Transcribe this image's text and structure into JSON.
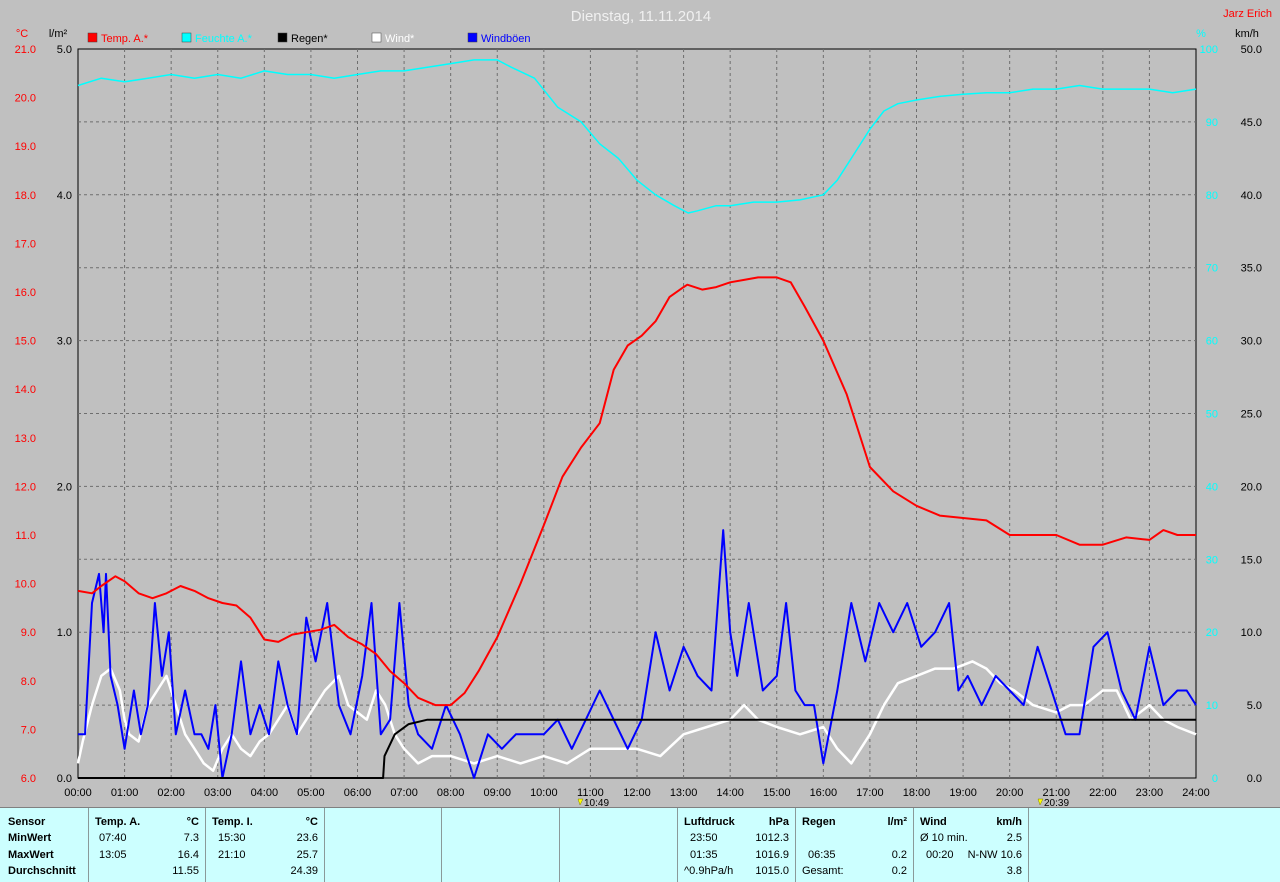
{
  "header": {
    "title": "Dienstag, 11.11.2014",
    "author": "Jarz Erich"
  },
  "axes": {
    "left_temp_unit": "°C",
    "left_rain_unit": "l/m²",
    "right_hum_unit": "%",
    "right_wind_unit": "km/h",
    "temp_ticks": [
      "21.0",
      "20.0",
      "19.0",
      "18.0",
      "17.0",
      "16.0",
      "15.0",
      "14.0",
      "13.0",
      "12.0",
      "11.0",
      "10.0",
      "9.0",
      "8.0",
      "7.0",
      "6.0"
    ],
    "rain_ticks": [
      "5.0",
      "4.0",
      "3.0",
      "2.0",
      "1.0",
      "0.0"
    ],
    "hum_ticks": [
      "100",
      "90",
      "80",
      "70",
      "60",
      "50",
      "40",
      "30",
      "20",
      "10",
      "0"
    ],
    "wind_ticks": [
      "50.0",
      "45.0",
      "40.0",
      "35.0",
      "30.0",
      "25.0",
      "20.0",
      "15.0",
      "10.0",
      "5.0",
      "0.0"
    ],
    "time_ticks": [
      "00:00",
      "01:00",
      "02:00",
      "03:00",
      "04:00",
      "05:00",
      "06:00",
      "07:00",
      "08:00",
      "09:00",
      "10:00",
      "11:00",
      "12:00",
      "13:00",
      "14:00",
      "15:00",
      "16:00",
      "17:00",
      "18:00",
      "19:00",
      "20:00",
      "21:00",
      "22:00",
      "23:00",
      "24:00"
    ],
    "sunrise": "10:49",
    "sunset": "20:39"
  },
  "legend": [
    {
      "label": "Temp. A.*",
      "color": "#ff0000"
    },
    {
      "label": "Feuchte A.*",
      "color": "#00ffff"
    },
    {
      "label": "Regen*",
      "color": "#000000"
    },
    {
      "label": "Wind*",
      "color": "#ffffff"
    },
    {
      "label": "Windböen",
      "color": "#0000ff"
    }
  ],
  "chart_data": {
    "type": "line",
    "title": "Dienstag, 11.11.2014",
    "x_unit": "hours",
    "xlim": [
      0,
      24
    ],
    "grid": true,
    "series": [
      {
        "name": "Temp. A.*",
        "color": "#ff0000",
        "axis": "temp",
        "ylim": [
          6,
          21
        ],
        "x": [
          0,
          0.3,
          0.5,
          0.8,
          1.0,
          1.3,
          1.6,
          1.9,
          2.2,
          2.5,
          2.8,
          3.1,
          3.4,
          3.7,
          4.0,
          4.3,
          4.6,
          4.9,
          5.2,
          5.5,
          5.8,
          6.1,
          6.4,
          6.7,
          7.0,
          7.3,
          7.67,
          8.0,
          8.3,
          8.6,
          9.0,
          9.5,
          10.0,
          10.4,
          10.8,
          11.2,
          11.5,
          11.8,
          12.1,
          12.4,
          12.7,
          13.0,
          13.08,
          13.4,
          13.7,
          14.0,
          14.3,
          14.6,
          15.0,
          15.3,
          15.6,
          16.0,
          16.5,
          17.0,
          17.5,
          18.0,
          18.5,
          19.0,
          19.5,
          20.0,
          20.5,
          21.0,
          21.5,
          22.0,
          22.5,
          23.0,
          23.3,
          23.6,
          24.0
        ],
        "y": [
          9.85,
          9.8,
          9.95,
          10.15,
          10.05,
          9.8,
          9.7,
          9.8,
          9.95,
          9.85,
          9.7,
          9.6,
          9.55,
          9.3,
          8.85,
          8.8,
          8.95,
          9.0,
          9.05,
          9.15,
          8.9,
          8.75,
          8.55,
          8.2,
          7.95,
          7.65,
          7.5,
          7.5,
          7.75,
          8.2,
          8.9,
          10.0,
          11.2,
          12.2,
          12.8,
          13.3,
          14.4,
          14.9,
          15.1,
          15.4,
          15.9,
          16.1,
          16.15,
          16.05,
          16.1,
          16.2,
          16.25,
          16.3,
          16.3,
          16.2,
          15.7,
          15.0,
          13.9,
          12.4,
          11.9,
          11.6,
          11.4,
          11.35,
          11.3,
          11.0,
          11.0,
          11.0,
          10.8,
          10.8,
          10.95,
          10.9,
          11.1,
          11.0,
          11.0
        ]
      },
      {
        "name": "Feuchte A.*",
        "color": "#00ffff",
        "axis": "hum",
        "ylim": [
          0,
          100
        ],
        "x": [
          0,
          0.5,
          1.0,
          1.5,
          2.0,
          2.5,
          3.0,
          3.5,
          4.0,
          4.5,
          5.0,
          5.5,
          6.0,
          6.5,
          7.0,
          7.5,
          8.0,
          8.5,
          9.0,
          9.3,
          9.8,
          10.3,
          10.8,
          11.2,
          11.6,
          12.0,
          12.4,
          12.8,
          13.1,
          13.3,
          13.7,
          14.0,
          14.5,
          15.0,
          15.5,
          16.0,
          16.3,
          16.7,
          17.0,
          17.3,
          17.6,
          18.0,
          18.5,
          19.0,
          19.5,
          20.0,
          20.5,
          21.0,
          21.5,
          22.0,
          22.5,
          23.0,
          23.5,
          24.0
        ],
        "y": [
          95,
          96,
          95.5,
          96,
          96.5,
          96,
          96.5,
          96,
          97,
          96.5,
          96.5,
          96,
          96.5,
          97,
          97,
          97.5,
          98,
          98.5,
          98.5,
          97.5,
          96,
          92,
          90,
          87,
          85,
          82,
          80,
          78.5,
          77.5,
          77.8,
          78.5,
          78.5,
          79,
          79,
          79.3,
          80,
          82,
          86,
          89,
          91.5,
          92.5,
          93,
          93.5,
          93.8,
          94,
          94,
          94.5,
          94.5,
          95,
          94.5,
          94.5,
          94.5,
          94,
          94.5
        ]
      },
      {
        "name": "Regen*",
        "color": "#000000",
        "axis": "rain",
        "ylim": [
          0,
          5
        ],
        "x": [
          0,
          6.55,
          6.58,
          6.8,
          7.1,
          7.5,
          8.0,
          24.0
        ],
        "y": [
          0,
          0,
          0.15,
          0.3,
          0.37,
          0.4,
          0.4,
          0.4
        ]
      },
      {
        "name": "Wind*",
        "color": "#ffffff",
        "axis": "wind",
        "ylim": [
          0,
          50
        ],
        "x": [
          0,
          0.1,
          0.3,
          0.5,
          0.7,
          0.9,
          1.0,
          1.1,
          1.3,
          1.5,
          1.7,
          1.9,
          2.1,
          2.3,
          2.5,
          2.7,
          2.9,
          3.1,
          3.3,
          3.5,
          3.7,
          3.9,
          4.1,
          4.3,
          4.5,
          4.7,
          4.9,
          5.1,
          5.3,
          5.6,
          5.8,
          6.0,
          6.2,
          6.4,
          6.6,
          6.8,
          7.0,
          7.3,
          7.6,
          8.0,
          8.5,
          9.0,
          9.5,
          10.0,
          10.5,
          11.0,
          11.5,
          12.0,
          12.5,
          13.0,
          13.5,
          14.0,
          14.3,
          14.6,
          15.0,
          15.5,
          16.0,
          16.3,
          16.6,
          17.0,
          17.3,
          17.6,
          18.0,
          18.4,
          18.8,
          19.2,
          19.5,
          19.8,
          20.1,
          20.5,
          21.0,
          21.3,
          21.6,
          22.0,
          22.3,
          22.6,
          23.0,
          23.3,
          23.6,
          24.0
        ],
        "y": [
          1,
          2.5,
          5,
          7,
          7.5,
          6,
          4,
          3,
          2.5,
          5,
          6,
          7,
          5,
          3,
          2,
          1,
          0.5,
          2,
          3,
          2,
          1.5,
          2.5,
          3,
          4,
          5,
          3,
          4,
          5,
          6,
          7,
          5,
          4.5,
          4,
          6,
          5,
          3,
          2,
          1,
          1.5,
          1.5,
          1,
          1.5,
          1,
          1.5,
          1,
          2,
          2,
          2,
          1.5,
          3,
          3.5,
          4,
          5,
          4,
          3.5,
          3,
          3.5,
          2,
          1,
          3,
          5,
          6.5,
          7,
          7.5,
          7.5,
          8,
          7.5,
          6.5,
          6,
          5,
          4.5,
          5,
          5,
          6,
          6,
          4,
          5,
          4,
          3.5,
          3
        ]
      },
      {
        "name": "Windböen",
        "color": "#0000ff",
        "axis": "wind",
        "ylim": [
          0,
          50
        ],
        "x": [
          0,
          0.15,
          0.3,
          0.45,
          0.55,
          0.6,
          0.7,
          0.85,
          1.0,
          1.2,
          1.35,
          1.5,
          1.65,
          1.8,
          1.95,
          2.1,
          2.3,
          2.5,
          2.65,
          2.8,
          2.95,
          3.1,
          3.3,
          3.5,
          3.7,
          3.9,
          4.1,
          4.3,
          4.5,
          4.7,
          4.9,
          5.1,
          5.35,
          5.6,
          5.85,
          6.1,
          6.3,
          6.5,
          6.7,
          6.9,
          7.1,
          7.3,
          7.6,
          7.9,
          8.2,
          8.5,
          8.8,
          9.1,
          9.4,
          9.7,
          10.0,
          10.3,
          10.6,
          10.9,
          11.2,
          11.5,
          11.8,
          12.1,
          12.4,
          12.7,
          13.0,
          13.3,
          13.6,
          13.85,
          14.0,
          14.15,
          14.4,
          14.7,
          15.0,
          15.2,
          15.4,
          15.6,
          15.8,
          16.0,
          16.3,
          16.6,
          16.9,
          17.2,
          17.5,
          17.8,
          18.1,
          18.4,
          18.7,
          18.9,
          19.1,
          19.4,
          19.7,
          20.0,
          20.3,
          20.6,
          20.9,
          21.2,
          21.5,
          21.8,
          22.1,
          22.4,
          22.7,
          23.0,
          23.3,
          23.6,
          23.8,
          24.0
        ],
        "y": [
          3,
          3,
          12,
          14,
          10,
          14,
          7,
          5,
          2,
          6,
          3,
          5,
          12,
          7,
          10,
          3,
          6,
          3,
          3,
          2,
          5,
          0,
          3,
          8,
          3,
          5,
          3,
          8,
          5,
          3,
          11,
          8,
          12,
          5,
          3,
          7,
          12,
          3,
          4,
          12,
          5,
          3,
          2,
          5,
          3,
          0,
          3,
          2,
          3,
          3,
          3,
          4,
          2,
          4,
          6,
          4,
          2,
          4,
          10,
          6,
          9,
          7,
          6,
          17,
          10,
          7,
          12,
          6,
          7,
          12,
          6,
          5,
          5,
          1,
          6,
          12,
          8,
          12,
          10,
          12,
          9,
          10,
          12,
          6,
          7,
          5,
          7,
          6,
          5,
          9,
          6,
          3,
          3,
          9,
          10,
          6,
          4,
          9,
          5,
          6,
          6,
          5
        ]
      }
    ]
  },
  "stats": {
    "col1": {
      "h": "Sensor",
      "r1": "MinWert",
      "r2": "MaxWert",
      "r3": "Durchschnitt"
    },
    "col2": {
      "h": "Temp. A.",
      "u": "°C",
      "r1t": "07:40",
      "r1v": "7.3",
      "r2t": "13:05",
      "r2v": "16.4",
      "r3v": "11.55"
    },
    "col3": {
      "h": "Temp. I.",
      "u": "°C",
      "r1t": "15:30",
      "r1v": "23.6",
      "r2t": "21:10",
      "r2v": "25.7",
      "r3v": "24.39"
    },
    "col4": {
      "h": "Luftdruck",
      "u": "hPa",
      "r1t": "23:50",
      "r1v": "1012.3",
      "r2t": "01:35",
      "r2v": "1016.9",
      "r3t": "^0.9hPa/h",
      "r3v": "1015.0"
    },
    "col5": {
      "h": "Regen",
      "u": "l/m²",
      "r2t": "06:35",
      "r2v": "0.2",
      "r3t": "Gesamt:",
      "r3v": "0.2"
    },
    "col6": {
      "h": "Wind",
      "u": "km/h",
      "r1t": "Ø 10 min.",
      "r1v": "2.5",
      "r2t": "00:20",
      "r2v": "N-NW 10.6",
      "r3v": "3.8"
    }
  }
}
